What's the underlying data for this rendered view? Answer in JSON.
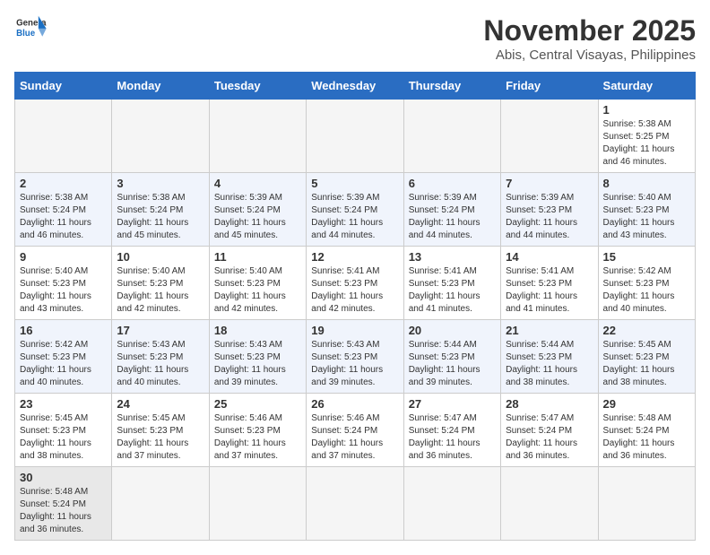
{
  "header": {
    "logo_general": "General",
    "logo_blue": "Blue",
    "title": "November 2025",
    "subtitle": "Abis, Central Visayas, Philippines"
  },
  "weekdays": [
    "Sunday",
    "Monday",
    "Tuesday",
    "Wednesday",
    "Thursday",
    "Friday",
    "Saturday"
  ],
  "weeks": [
    [
      {
        "day": "",
        "info": ""
      },
      {
        "day": "",
        "info": ""
      },
      {
        "day": "",
        "info": ""
      },
      {
        "day": "",
        "info": ""
      },
      {
        "day": "",
        "info": ""
      },
      {
        "day": "",
        "info": ""
      },
      {
        "day": "1",
        "info": "Sunrise: 5:38 AM\nSunset: 5:25 PM\nDaylight: 11 hours\nand 46 minutes."
      }
    ],
    [
      {
        "day": "2",
        "info": "Sunrise: 5:38 AM\nSunset: 5:24 PM\nDaylight: 11 hours\nand 46 minutes."
      },
      {
        "day": "3",
        "info": "Sunrise: 5:38 AM\nSunset: 5:24 PM\nDaylight: 11 hours\nand 45 minutes."
      },
      {
        "day": "4",
        "info": "Sunrise: 5:39 AM\nSunset: 5:24 PM\nDaylight: 11 hours\nand 45 minutes."
      },
      {
        "day": "5",
        "info": "Sunrise: 5:39 AM\nSunset: 5:24 PM\nDaylight: 11 hours\nand 44 minutes."
      },
      {
        "day": "6",
        "info": "Sunrise: 5:39 AM\nSunset: 5:24 PM\nDaylight: 11 hours\nand 44 minutes."
      },
      {
        "day": "7",
        "info": "Sunrise: 5:39 AM\nSunset: 5:23 PM\nDaylight: 11 hours\nand 44 minutes."
      },
      {
        "day": "8",
        "info": "Sunrise: 5:40 AM\nSunset: 5:23 PM\nDaylight: 11 hours\nand 43 minutes."
      }
    ],
    [
      {
        "day": "9",
        "info": "Sunrise: 5:40 AM\nSunset: 5:23 PM\nDaylight: 11 hours\nand 43 minutes."
      },
      {
        "day": "10",
        "info": "Sunrise: 5:40 AM\nSunset: 5:23 PM\nDaylight: 11 hours\nand 42 minutes."
      },
      {
        "day": "11",
        "info": "Sunrise: 5:40 AM\nSunset: 5:23 PM\nDaylight: 11 hours\nand 42 minutes."
      },
      {
        "day": "12",
        "info": "Sunrise: 5:41 AM\nSunset: 5:23 PM\nDaylight: 11 hours\nand 42 minutes."
      },
      {
        "day": "13",
        "info": "Sunrise: 5:41 AM\nSunset: 5:23 PM\nDaylight: 11 hours\nand 41 minutes."
      },
      {
        "day": "14",
        "info": "Sunrise: 5:41 AM\nSunset: 5:23 PM\nDaylight: 11 hours\nand 41 minutes."
      },
      {
        "day": "15",
        "info": "Sunrise: 5:42 AM\nSunset: 5:23 PM\nDaylight: 11 hours\nand 40 minutes."
      }
    ],
    [
      {
        "day": "16",
        "info": "Sunrise: 5:42 AM\nSunset: 5:23 PM\nDaylight: 11 hours\nand 40 minutes."
      },
      {
        "day": "17",
        "info": "Sunrise: 5:43 AM\nSunset: 5:23 PM\nDaylight: 11 hours\nand 40 minutes."
      },
      {
        "day": "18",
        "info": "Sunrise: 5:43 AM\nSunset: 5:23 PM\nDaylight: 11 hours\nand 39 minutes."
      },
      {
        "day": "19",
        "info": "Sunrise: 5:43 AM\nSunset: 5:23 PM\nDaylight: 11 hours\nand 39 minutes."
      },
      {
        "day": "20",
        "info": "Sunrise: 5:44 AM\nSunset: 5:23 PM\nDaylight: 11 hours\nand 39 minutes."
      },
      {
        "day": "21",
        "info": "Sunrise: 5:44 AM\nSunset: 5:23 PM\nDaylight: 11 hours\nand 38 minutes."
      },
      {
        "day": "22",
        "info": "Sunrise: 5:45 AM\nSunset: 5:23 PM\nDaylight: 11 hours\nand 38 minutes."
      }
    ],
    [
      {
        "day": "23",
        "info": "Sunrise: 5:45 AM\nSunset: 5:23 PM\nDaylight: 11 hours\nand 38 minutes."
      },
      {
        "day": "24",
        "info": "Sunrise: 5:45 AM\nSunset: 5:23 PM\nDaylight: 11 hours\nand 37 minutes."
      },
      {
        "day": "25",
        "info": "Sunrise: 5:46 AM\nSunset: 5:23 PM\nDaylight: 11 hours\nand 37 minutes."
      },
      {
        "day": "26",
        "info": "Sunrise: 5:46 AM\nSunset: 5:24 PM\nDaylight: 11 hours\nand 37 minutes."
      },
      {
        "day": "27",
        "info": "Sunrise: 5:47 AM\nSunset: 5:24 PM\nDaylight: 11 hours\nand 36 minutes."
      },
      {
        "day": "28",
        "info": "Sunrise: 5:47 AM\nSunset: 5:24 PM\nDaylight: 11 hours\nand 36 minutes."
      },
      {
        "day": "29",
        "info": "Sunrise: 5:48 AM\nSunset: 5:24 PM\nDaylight: 11 hours\nand 36 minutes."
      }
    ],
    [
      {
        "day": "30",
        "info": "Sunrise: 5:48 AM\nSunset: 5:24 PM\nDaylight: 11 hours\nand 36 minutes."
      },
      {
        "day": "",
        "info": ""
      },
      {
        "day": "",
        "info": ""
      },
      {
        "day": "",
        "info": ""
      },
      {
        "day": "",
        "info": ""
      },
      {
        "day": "",
        "info": ""
      },
      {
        "day": "",
        "info": ""
      }
    ]
  ]
}
